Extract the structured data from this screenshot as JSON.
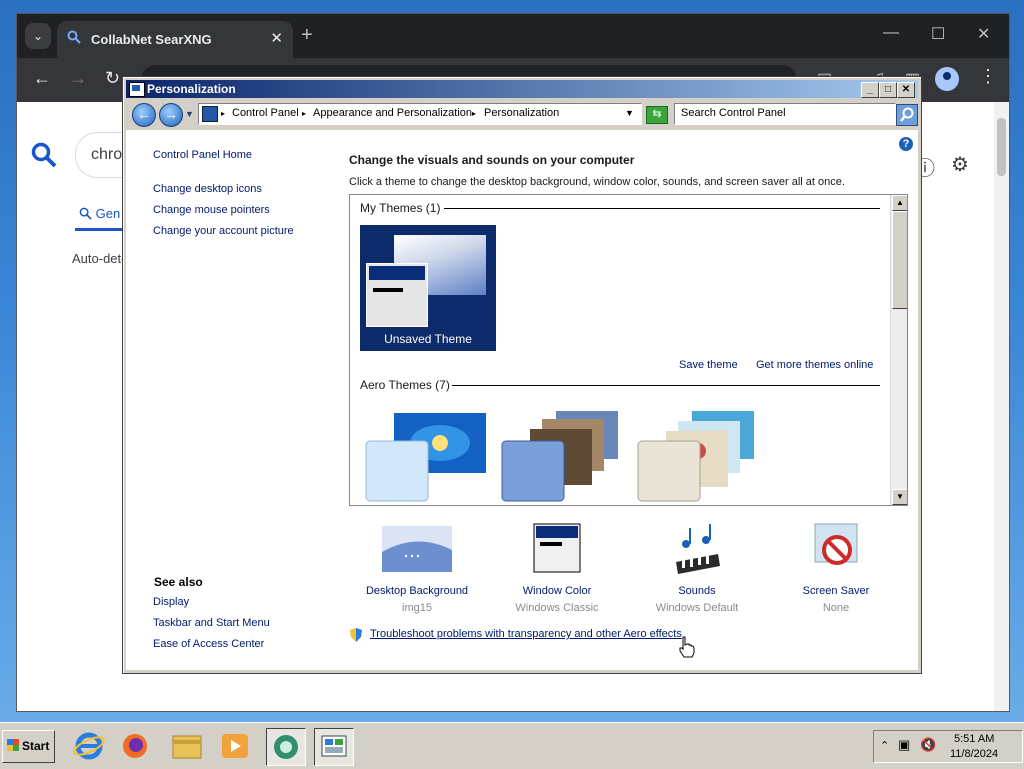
{
  "browser": {
    "tab_title": "CollabNet SearXNG",
    "tab_close": "✕",
    "new_tab": "+",
    "search_partial": "chro",
    "tab_general": "Gen",
    "auto_detect": "Auto-dete"
  },
  "personalization": {
    "window_title": "Personalization",
    "breadcrumbs": [
      "Control Panel",
      "Appearance and Personalization",
      "Personalization"
    ],
    "search_placeholder": "Search Control Panel",
    "left_links": [
      "Control Panel Home",
      "Change desktop icons",
      "Change mouse pointers",
      "Change your account picture"
    ],
    "see_also_title": "See also",
    "see_also_links": [
      "Display",
      "Taskbar and Start Menu",
      "Ease of Access Center"
    ],
    "heading": "Change the visuals and sounds on your computer",
    "subheading": "Click a theme to change the desktop background, window color, sounds, and screen saver all at once.",
    "my_themes_label": "My Themes (1)",
    "unsaved_theme_label": "Unsaved Theme",
    "save_theme": "Save theme",
    "get_more_themes": "Get more themes online",
    "aero_themes_label": "Aero Themes (7)",
    "options": [
      {
        "name": "Desktop Background",
        "value": "img15"
      },
      {
        "name": "Window Color",
        "value": "Windows Classic"
      },
      {
        "name": "Sounds",
        "value": "Windows Default"
      },
      {
        "name": "Screen Saver",
        "value": "None"
      }
    ],
    "troubleshoot_link": "Troubleshoot problems with transparency and other Aero effects"
  },
  "taskbar": {
    "start_label": "Start",
    "time": "5:51 AM",
    "date": "11/8/2024"
  },
  "colors": {
    "link": "#001a6e",
    "titlebar_start": "#0a246a",
    "titlebar_end": "#a6caf0",
    "chrome_dark": "#202124",
    "searx_blue": "#1a56c9"
  }
}
